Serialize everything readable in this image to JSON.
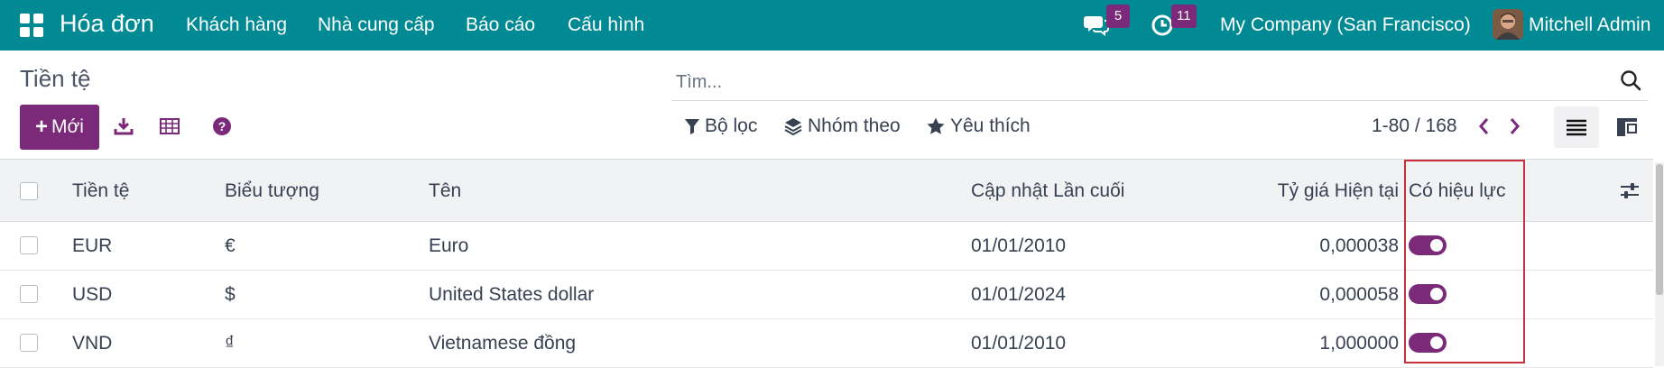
{
  "navbar": {
    "app_title": "Hóa đơn",
    "menu": [
      "Khách hàng",
      "Nhà cung cấp",
      "Báo cáo",
      "Cấu hình"
    ],
    "messages_badge": "5",
    "activities_badge": "11",
    "company": "My Company (San Francisco)",
    "user": "Mitchell Admin"
  },
  "control_panel": {
    "title": "Tiền tệ",
    "search_placeholder": "Tìm...",
    "new_button": "Mới",
    "filters_label": "Bộ lọc",
    "group_by_label": "Nhóm theo",
    "favorites_label": "Yêu thích",
    "pager": "1-80 / 168"
  },
  "table": {
    "columns": [
      "Tiền tệ",
      "Biểu tượng",
      "Tên",
      "Cập nhật Lần cuối",
      "Tỷ giá Hiện tại",
      "Có hiệu lực"
    ],
    "rows": [
      {
        "code": "EUR",
        "symbol": "€",
        "name": "Euro",
        "last_update": "01/01/2010",
        "rate": "0,000038",
        "active": true
      },
      {
        "code": "USD",
        "symbol": "$",
        "name": "United States dollar",
        "last_update": "01/01/2024",
        "rate": "0,000058",
        "active": true
      },
      {
        "code": "VND",
        "symbol": "₫",
        "name": "Vietnamese đồng",
        "last_update": "01/01/2010",
        "rate": "1,000000",
        "active": true
      }
    ]
  },
  "colors": {
    "navbar": "#018a93",
    "primary": "#7b2a7a",
    "highlight": "#c9303d"
  },
  "icons": [
    "apps-icon",
    "chat-icon",
    "clock-icon",
    "search-icon",
    "download-icon",
    "spreadsheet-icon",
    "help-icon",
    "filter-icon",
    "layers-icon",
    "star-icon",
    "chevron-left-icon",
    "chevron-right-icon",
    "list-view-icon",
    "kanban-view-icon",
    "column-settings-icon"
  ]
}
